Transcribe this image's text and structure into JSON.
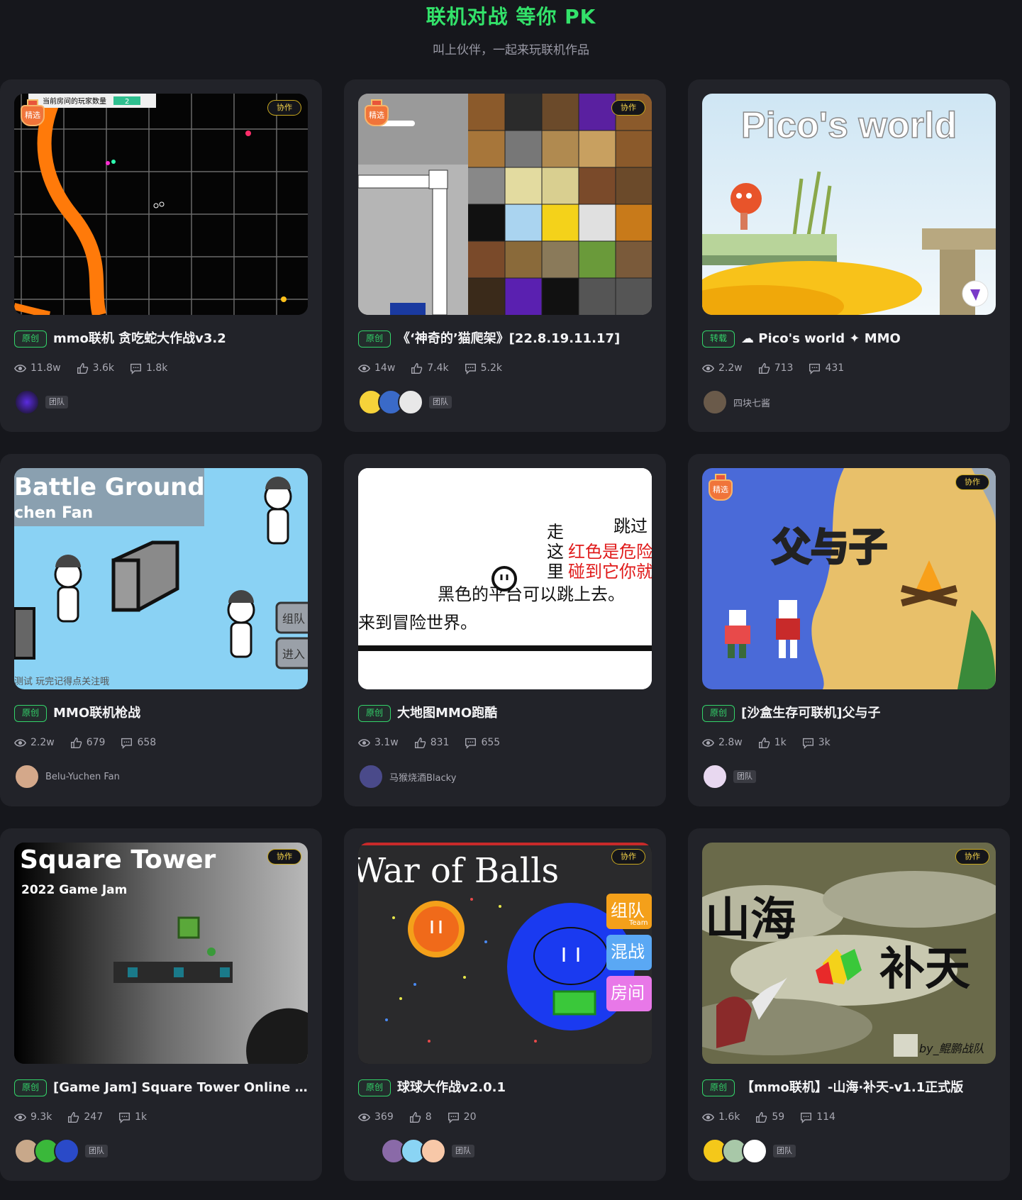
{
  "header": {
    "title": "联机对战 等你 PK",
    "subtitle": "叫上伙伴，一起来玩联机作品"
  },
  "badges": {
    "featured": "精选",
    "collab": "协作",
    "team": "团队"
  },
  "cards": [
    {
      "tag": "原创",
      "name": "mmo联机 贪吃蛇大作战v3.2",
      "views": "11.8w",
      "likes": "3.6k",
      "comments": "1.8k",
      "featured": true,
      "collab": true,
      "author_type": "team",
      "thumb_text": [
        "当前房间的玩家数量",
        "2"
      ]
    },
    {
      "tag": "原创",
      "name": "《‘神奇的’猫爬架》[22.8.19.11.17]",
      "views": "14w",
      "likes": "7.4k",
      "comments": "5.2k",
      "featured": true,
      "collab": true,
      "author_type": "team"
    },
    {
      "tag": "转载",
      "name": "☁ Pico's world ✦ MMO",
      "views": "2.2w",
      "likes": "713",
      "comments": "431",
      "featured": false,
      "collab": false,
      "author_type": "user",
      "author": "四块七酱",
      "thumb_text": [
        "Pico's world"
      ]
    },
    {
      "tag": "原创",
      "name": "MMO联机枪战",
      "views": "2.2w",
      "likes": "679",
      "comments": "658",
      "featured": false,
      "collab": false,
      "author_type": "user",
      "author": "Belu-Yuchen Fan",
      "thumb_text": [
        "Battle Ground",
        "chen Fan",
        "组队",
        "进入",
        "测试 玩完记得点关注哦"
      ]
    },
    {
      "tag": "原创",
      "name": "大地图MMO跑酷",
      "views": "3.1w",
      "likes": "831",
      "comments": "655",
      "featured": false,
      "collab": false,
      "author_type": "user",
      "author": "马猴烧酒Blacky",
      "thumb_text": [
        "走",
        "跳过",
        "这",
        "红色是危险",
        "里",
        "碰到它你就",
        "黑色的平台可以跳上去。",
        "来到冒险世界。"
      ]
    },
    {
      "tag": "原创",
      "name": "[沙盒生存可联机]父与子",
      "views": "2.8w",
      "likes": "1k",
      "comments": "3k",
      "featured": true,
      "collab": true,
      "author_type": "team",
      "thumb_text": [
        "父与子"
      ]
    },
    {
      "tag": "原创",
      "name": "[Game Jam] Square Tower Online 联机...",
      "views": "9.3k",
      "likes": "247",
      "comments": "1k",
      "featured": false,
      "collab": true,
      "author_type": "team",
      "thumb_text": [
        "Square Tower",
        "2022 Game Jam"
      ]
    },
    {
      "tag": "原创",
      "name": "球球大作战v2.0.1",
      "views": "369",
      "likes": "8",
      "comments": "20",
      "featured": false,
      "collab": true,
      "author_type": "team",
      "thumb_text": [
        "War of Balls",
        "组队",
        "Team",
        "混战",
        "房间"
      ]
    },
    {
      "tag": "原创",
      "name": "【mmo联机】-山海·补天-v1.1正式版",
      "views": "1.6k",
      "likes": "59",
      "comments": "114",
      "featured": false,
      "collab": true,
      "author_type": "team",
      "thumb_text": [
        "山海",
        "补天",
        "by_鲲鹏战队"
      ]
    }
  ],
  "icons": {
    "views": "eye-icon",
    "likes": "thumbs-up-icon",
    "comments": "comment-icon"
  },
  "colors": {
    "accent": "#33e26a",
    "background": "#16171c",
    "card": "#222329",
    "collab": "#f3d24a",
    "featured": "#f0743a"
  }
}
